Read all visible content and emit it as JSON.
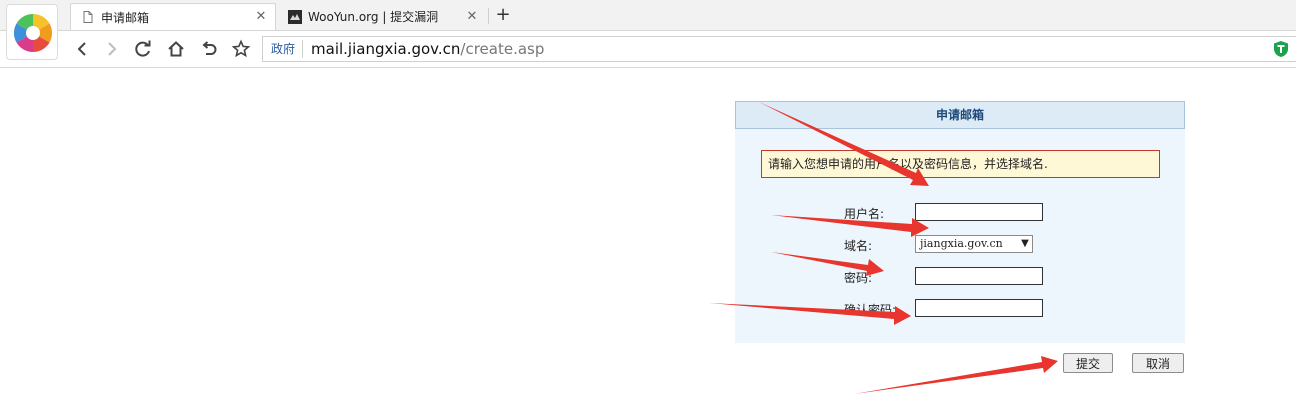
{
  "browser": {
    "tabs": [
      {
        "label": "申请邮箱",
        "active": true,
        "icon": "page-icon"
      },
      {
        "label": "WooYun.org | 提交漏洞",
        "active": false,
        "icon": "wooyun-favicon-icon"
      }
    ],
    "address_badge": "政府",
    "url_host": "mail.jiangxia.gov.cn",
    "url_path": "/create.asp"
  },
  "form": {
    "title": "申请邮箱",
    "notice": "请输入您想申请的用户名以及密码信息，并选择域名.",
    "fields": {
      "username": {
        "label": "用户名:",
        "value": ""
      },
      "domain": {
        "label": "域名:",
        "selected": "jiangxia.gov.cn"
      },
      "password": {
        "label": "密码:",
        "value": ""
      },
      "confirm": {
        "label": "确认密码:",
        "value": ""
      }
    },
    "submit_label": "提交",
    "cancel_label": "取消"
  },
  "colors": {
    "annotation_arrow": "#e8352e",
    "header_bg": "#dcebf6",
    "body_bg": "#eef6fd",
    "notice_bg": "#fff8d6",
    "notice_border": "#c0392b"
  }
}
